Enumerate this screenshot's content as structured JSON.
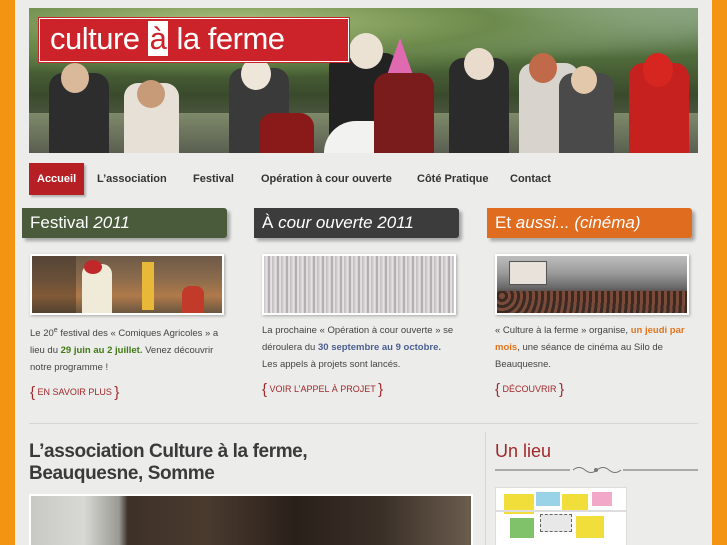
{
  "banner": {
    "logo_part1": "culture",
    "logo_part2": "à",
    "logo_part3": "la ferme"
  },
  "nav": {
    "items": [
      {
        "label": "Accueil",
        "active": true
      },
      {
        "label": "L’association"
      },
      {
        "label": "Festival"
      },
      {
        "label": "Opération à cour ouverte"
      },
      {
        "label": "Côté Pratique"
      },
      {
        "label": "Contact"
      }
    ]
  },
  "columns": {
    "festival": {
      "title_plain": "Festival ",
      "title_italic": "2011",
      "color": "#4a5b3c",
      "text_a": "Le 20",
      "text_sup": "e",
      "text_b": " festival des « Comiques Agricoles » a lieu du ",
      "text_highlight": "29 juin au 2 juillet.",
      "text_c": " Venez découvrir notre programme !",
      "link": "EN SAVOIR PLUS"
    },
    "cour": {
      "title_plain": "À ",
      "title_italic": "cour ouverte 2011",
      "color": "#3c3c3c",
      "text_a": "La prochaine « Opération à cour ouverte » se déroulera du ",
      "text_highlight": "30 septembre au 9 octobre.",
      "text_b": " Les appels à projets sont lancés.",
      "link": "VOIR L’APPEL À PROJET"
    },
    "aussi": {
      "title_plain": "Et ",
      "title_italic": "aussi... (cinéma)",
      "color": "#e06c1f",
      "text_a": "« Culture à la ferme » organise, ",
      "text_highlight": "un jeudi par mois",
      "text_b": ", une séance de cinéma au Silo de Beauquesne.",
      "link": "DÉCOUVRIR"
    }
  },
  "association": {
    "title": "L’association Culture à la ferme, Beauquesne, Somme"
  },
  "sidebar": {
    "title": "Un lieu"
  }
}
